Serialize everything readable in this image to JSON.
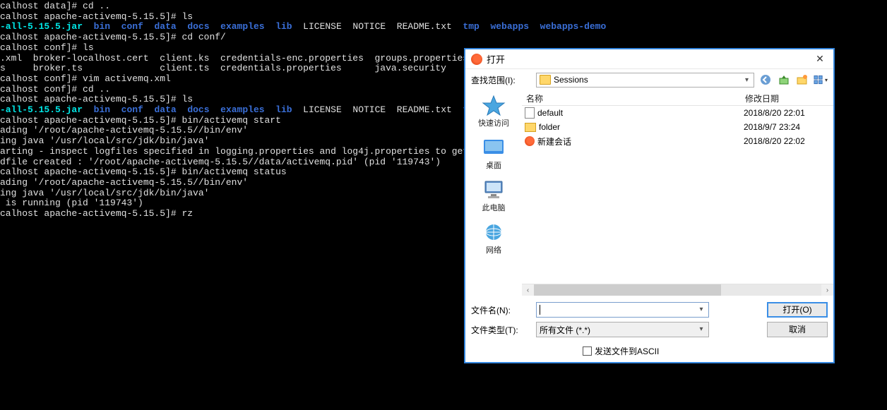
{
  "terminal": {
    "lines": [
      {
        "segments": [
          {
            "c": "white",
            "t": "calhost data]# cd .."
          }
        ]
      },
      {
        "segments": [
          {
            "c": "white",
            "t": "calhost apache-activemq-5.15.5]# ls"
          }
        ]
      },
      {
        "segments": [
          {
            "c": "cyan",
            "t": "-all-5.15.5.jar"
          },
          {
            "c": "white",
            "t": "  "
          },
          {
            "c": "blue",
            "t": "bin"
          },
          {
            "c": "white",
            "t": "  "
          },
          {
            "c": "blue",
            "t": "conf"
          },
          {
            "c": "white",
            "t": "  "
          },
          {
            "c": "blue",
            "t": "data"
          },
          {
            "c": "white",
            "t": "  "
          },
          {
            "c": "blue",
            "t": "docs"
          },
          {
            "c": "white",
            "t": "  "
          },
          {
            "c": "blue",
            "t": "examples"
          },
          {
            "c": "white",
            "t": "  "
          },
          {
            "c": "blue",
            "t": "lib"
          },
          {
            "c": "white",
            "t": "  LICENSE  NOTICE  README.txt  "
          },
          {
            "c": "blue",
            "t": "tmp"
          },
          {
            "c": "white",
            "t": "  "
          },
          {
            "c": "blue",
            "t": "webapps"
          },
          {
            "c": "white",
            "t": "  "
          },
          {
            "c": "blue",
            "t": "webapps-demo"
          }
        ]
      },
      {
        "segments": [
          {
            "c": "white",
            "t": "calhost apache-activemq-5.15.5]# cd conf/"
          }
        ]
      },
      {
        "segments": [
          {
            "c": "white",
            "t": "calhost conf]# ls"
          }
        ]
      },
      {
        "segments": [
          {
            "c": "white",
            "t": ".xml  broker-localhost.cert  client.ks  credentials-enc.properties  groups.properties  je"
          }
        ]
      },
      {
        "segments": [
          {
            "c": "white",
            "t": "s     broker.ts              client.ts  credentials.properties      java.security       je"
          }
        ]
      },
      {
        "segments": [
          {
            "c": "white",
            "t": "calhost conf]# vim activemq.xml"
          }
        ]
      },
      {
        "segments": [
          {
            "c": "white",
            "t": "calhost conf]# cd .."
          }
        ]
      },
      {
        "segments": [
          {
            "c": "white",
            "t": "calhost apache-activemq-5.15.5]# ls"
          }
        ]
      },
      {
        "segments": [
          {
            "c": "cyan",
            "t": "-all-5.15.5.jar"
          },
          {
            "c": "white",
            "t": "  "
          },
          {
            "c": "blue",
            "t": "bin"
          },
          {
            "c": "white",
            "t": "  "
          },
          {
            "c": "blue",
            "t": "conf"
          },
          {
            "c": "white",
            "t": "  "
          },
          {
            "c": "blue",
            "t": "data"
          },
          {
            "c": "white",
            "t": "  "
          },
          {
            "c": "blue",
            "t": "docs"
          },
          {
            "c": "white",
            "t": "  "
          },
          {
            "c": "blue",
            "t": "examples"
          },
          {
            "c": "white",
            "t": "  "
          },
          {
            "c": "blue",
            "t": "lib"
          },
          {
            "c": "white",
            "t": "  LICENSE  NOTICE  README.txt  "
          },
          {
            "c": "blue",
            "t": "tmp"
          }
        ]
      },
      {
        "segments": [
          {
            "c": "white",
            "t": "calhost apache-activemq-5.15.5]# bin/activemq start"
          }
        ]
      },
      {
        "segments": [
          {
            "c": "white",
            "t": "ading '/root/apache-activemq-5.15.5//bin/env'"
          }
        ]
      },
      {
        "segments": [
          {
            "c": "white",
            "t": "ing java '/usr/local/src/jdk/bin/java'"
          }
        ]
      },
      {
        "segments": [
          {
            "c": "white",
            "t": "arting - inspect logfiles specified in logging.properties and log4j.properties to get det"
          }
        ]
      },
      {
        "segments": [
          {
            "c": "white",
            "t": "dfile created : '/root/apache-activemq-5.15.5//data/activemq.pid' (pid '119743')"
          }
        ]
      },
      {
        "segments": [
          {
            "c": "white",
            "t": "calhost apache-activemq-5.15.5]# bin/activemq status"
          }
        ]
      },
      {
        "segments": [
          {
            "c": "white",
            "t": "ading '/root/apache-activemq-5.15.5//bin/env'"
          }
        ]
      },
      {
        "segments": [
          {
            "c": "white",
            "t": "ing java '/usr/local/src/jdk/bin/java'"
          }
        ]
      },
      {
        "segments": [
          {
            "c": "white",
            "t": " is running (pid '119743')"
          }
        ]
      },
      {
        "segments": [
          {
            "c": "white",
            "t": "calhost apache-activemq-5.15.5]# rz"
          }
        ]
      }
    ]
  },
  "dialog": {
    "title": "打开",
    "lookin_label": "查找范围(I):",
    "lookin_value": "Sessions",
    "places": [
      {
        "label": "快速访问",
        "icon": "quickaccess"
      },
      {
        "label": "桌面",
        "icon": "desktop"
      },
      {
        "label": "此电脑",
        "icon": "thispc"
      },
      {
        "label": "网络",
        "icon": "network"
      }
    ],
    "columns": {
      "name": "名称",
      "modified": "修改日期"
    },
    "files": [
      {
        "icon": "file",
        "name": "default",
        "date": "2018/8/20 22:01"
      },
      {
        "icon": "folder",
        "name": "folder",
        "date": "2018/9/7 23:24"
      },
      {
        "icon": "swirl",
        "name": "新建会话",
        "date": "2018/8/20 22:02"
      }
    ],
    "filename_label": "文件名(N):",
    "filename_value": "",
    "filetype_label": "文件类型(T):",
    "filetype_value": "所有文件 (*.*)",
    "open_btn": "打开(O)",
    "cancel_btn": "取消",
    "ascii_checkbox": "发送文件到ASCII"
  }
}
